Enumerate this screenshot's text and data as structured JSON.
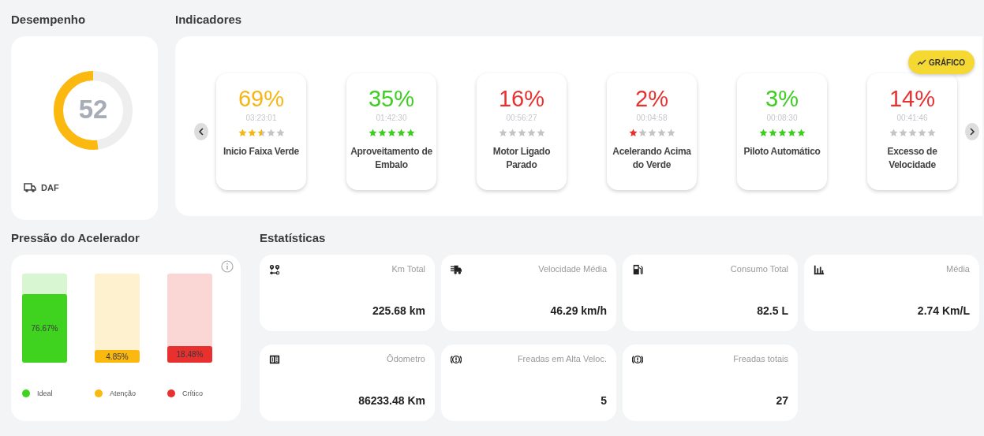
{
  "performance": {
    "title": "Desempenho",
    "gauge": {
      "value": "52",
      "level": 0.52
    },
    "vehicle": "DAF"
  },
  "indicators": {
    "title": "Indicadores",
    "chart_button": "GRÁFICO",
    "items": [
      {
        "percent": "69%",
        "time": "03:23:01",
        "stars": 2.5,
        "label": "Inicio Faixa Verde",
        "color": "#f7b515"
      },
      {
        "percent": "35%",
        "time": "01:42:30",
        "stars": 5,
        "label": "Aproveitamento de Embalo",
        "color": "#3dce1f"
      },
      {
        "percent": "16%",
        "time": "00:56:27",
        "stars": 0,
        "label": "Motor Ligado Parado",
        "color": "#e8302f"
      },
      {
        "percent": "2%",
        "time": "00:04:58",
        "stars": 1,
        "label": "Acelerando Acima do Verde",
        "color": "#e8302f"
      },
      {
        "percent": "3%",
        "time": "00:08:30",
        "stars": 5,
        "label": "Piloto Automático",
        "color": "#3dce1f"
      },
      {
        "percent": "14%",
        "time": "00:41:46",
        "stars": 0,
        "label": "Excesso de Velocidade",
        "color": "#e8302f"
      }
    ]
  },
  "pressure": {
    "title": "Pressão do Acelerador",
    "bars": [
      {
        "label": "Ideal",
        "value": "76.67%",
        "level": 0.7667,
        "color": "#3fd320"
      },
      {
        "label": "Atenção",
        "value": "4.85%",
        "level": 0.0485,
        "color": "#fbb80e"
      },
      {
        "label": "Crítico",
        "value": "18.48%",
        "level": 0.1848,
        "color": "#e8302f"
      }
    ]
  },
  "statistics": {
    "title": "Estatísticas",
    "cards": [
      {
        "kind": "route",
        "label": "Km Total",
        "value": "225.68 km"
      },
      {
        "kind": "speed",
        "label": "Velocidade Média",
        "value": "46.29 km/h"
      },
      {
        "kind": "fuel",
        "label": "Consumo Total",
        "value": "82.5 L"
      },
      {
        "kind": "average",
        "label": "Média",
        "value": "2.74 Km/L"
      },
      {
        "kind": "odometer",
        "label": "Ôdometro",
        "value": "86233.48 Km"
      },
      {
        "kind": "brake",
        "label": "Freadas em Alta Veloc.",
        "value": "5"
      },
      {
        "kind": "brake",
        "label": "Freadas totais",
        "value": "27"
      }
    ]
  }
}
